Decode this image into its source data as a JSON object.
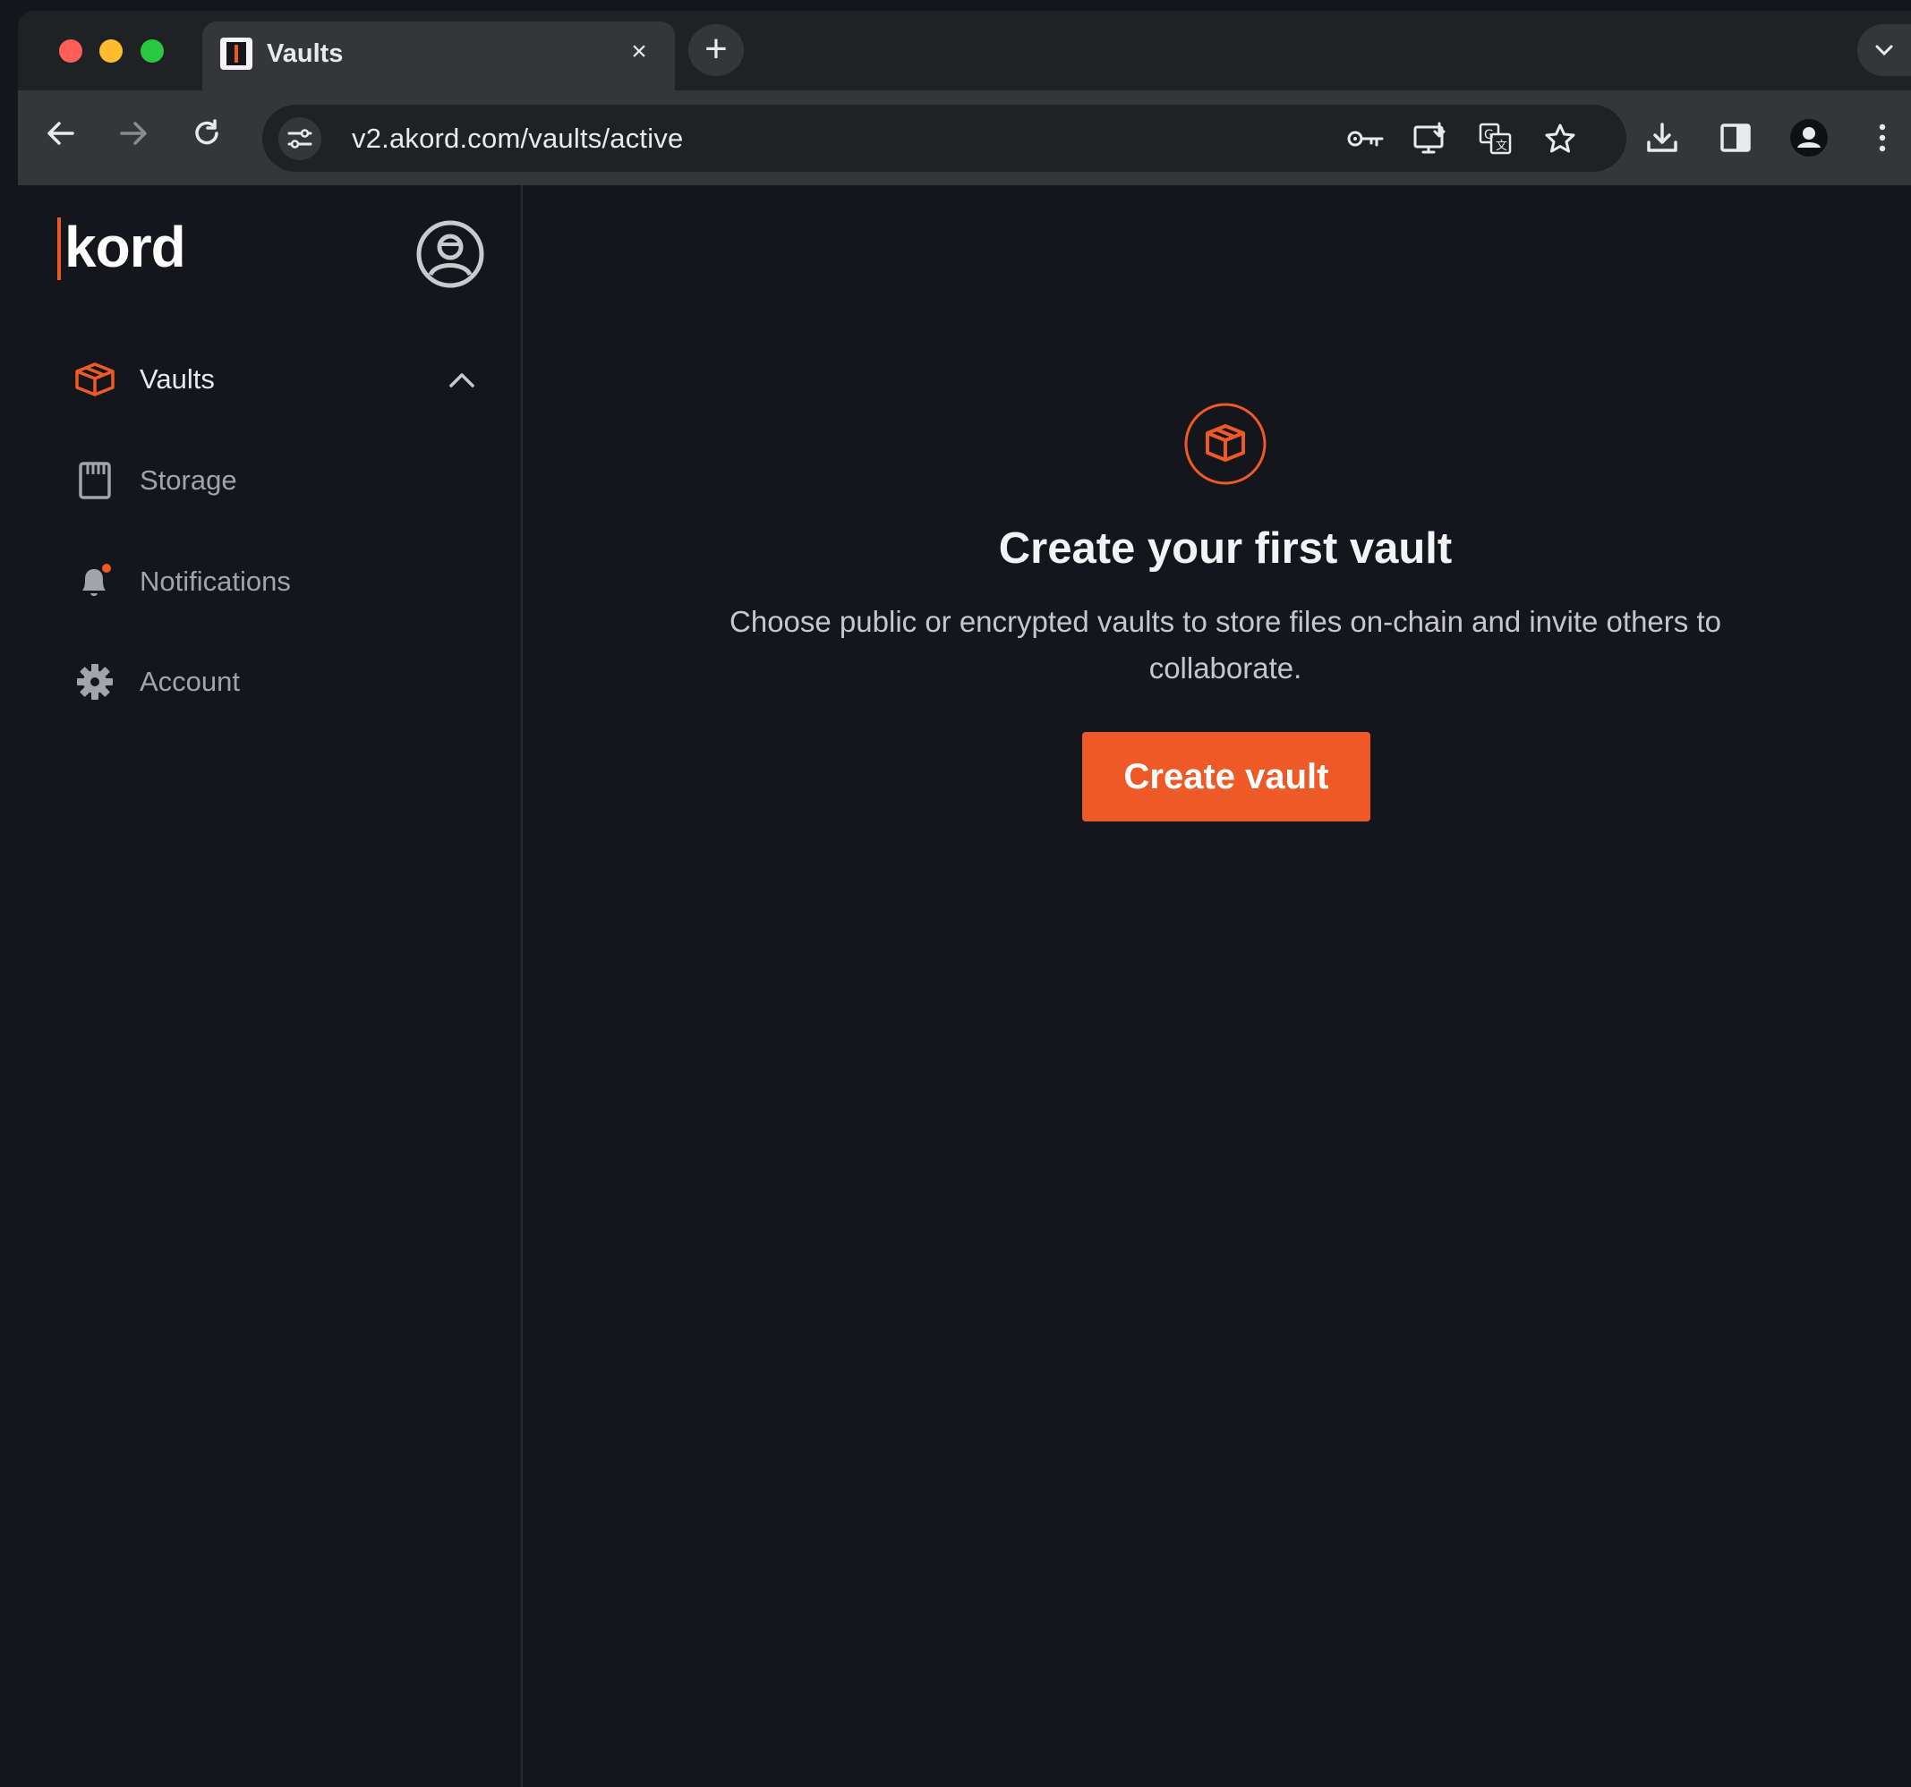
{
  "browser": {
    "tab_title": "Vaults",
    "tab_close": "×",
    "new_tab": "+",
    "tab_search": "⌄",
    "url": "v2.akord.com/vaults/active",
    "nav": {
      "back": "←",
      "forward": "→",
      "reload": "↻"
    }
  },
  "app": {
    "logo": "kord",
    "brand_color": "#ee5a27",
    "sidebar": {
      "items": [
        {
          "label": "Vaults",
          "icon": "vault-icon",
          "active": true,
          "expanded": true
        },
        {
          "label": "Storage",
          "icon": "storage-icon",
          "active": false
        },
        {
          "label": "Notifications",
          "icon": "bell-icon",
          "active": false
        },
        {
          "label": "Account",
          "icon": "gear-icon",
          "active": false
        }
      ]
    },
    "empty_state": {
      "icon": "vault-icon",
      "title": "Create your first vault",
      "description": "Choose public or encrypted vaults to store files on-chain and invite others to collaborate.",
      "button_label": "Create vault"
    }
  }
}
